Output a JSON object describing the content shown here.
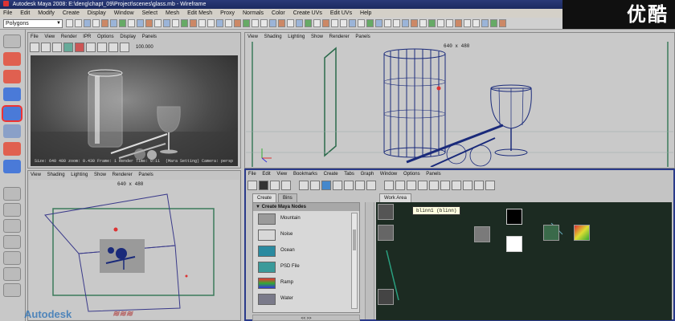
{
  "window": {
    "title": "Autodesk Maya 2008:  E:\\deng\\chapt_09\\Project\\scenes\\glass.mb     - Wireframe"
  },
  "menu": [
    "File",
    "Edit",
    "Modify",
    "Create",
    "Display",
    "Window",
    "Select",
    "Mesh",
    "Edit Mesh",
    "Proxy",
    "Normals",
    "Color",
    "Create UVs",
    "Edit UVs",
    "Help"
  ],
  "status_line": {
    "mode": "Polygons"
  },
  "logo": {
    "text": "优酷"
  },
  "render_view": {
    "menu": [
      "File",
      "View",
      "Render",
      "IPR",
      "Options",
      "Display",
      "Panels"
    ],
    "toolbar_value": "100.000",
    "info": "Size: 640 480  zoom: 0.430  Frame: 1   Render Time: 0:11",
    "camera": "Camera: persp",
    "render_layer": "(Mara Setting)"
  },
  "persp_view": {
    "menu": [
      "View",
      "Shading",
      "Lighting",
      "Show",
      "Renderer",
      "Panels"
    ],
    "resolution": "640 x 480"
  },
  "top_view": {
    "menu": [
      "View",
      "Shading",
      "Lighting",
      "Show",
      "Renderer",
      "Panels"
    ],
    "resolution": "640 x 480"
  },
  "hypershade": {
    "menu": [
      "File",
      "Edit",
      "View",
      "Bookmarks",
      "Create",
      "Tabs",
      "Graph",
      "Window",
      "Options",
      "Panels"
    ],
    "tabs": [
      "Create",
      "Bins"
    ],
    "list_header": "Create Maya Nodes",
    "items": [
      {
        "label": "Mountain",
        "color": "#9a9a9a"
      },
      {
        "label": "Noise",
        "color": "#d8d8d8"
      },
      {
        "label": "Ocean",
        "color": "#2a8aa0"
      },
      {
        "label": "PSD File",
        "color": "#3a9a9a"
      },
      {
        "label": "Ramp",
        "color": "#3a6ac8"
      },
      {
        "label": "Water",
        "color": "#7a7a8a"
      }
    ],
    "list_footer": "<<                    >>",
    "work_area_tab": "Work Area",
    "tooltip": "blinn1 (blinn)"
  }
}
